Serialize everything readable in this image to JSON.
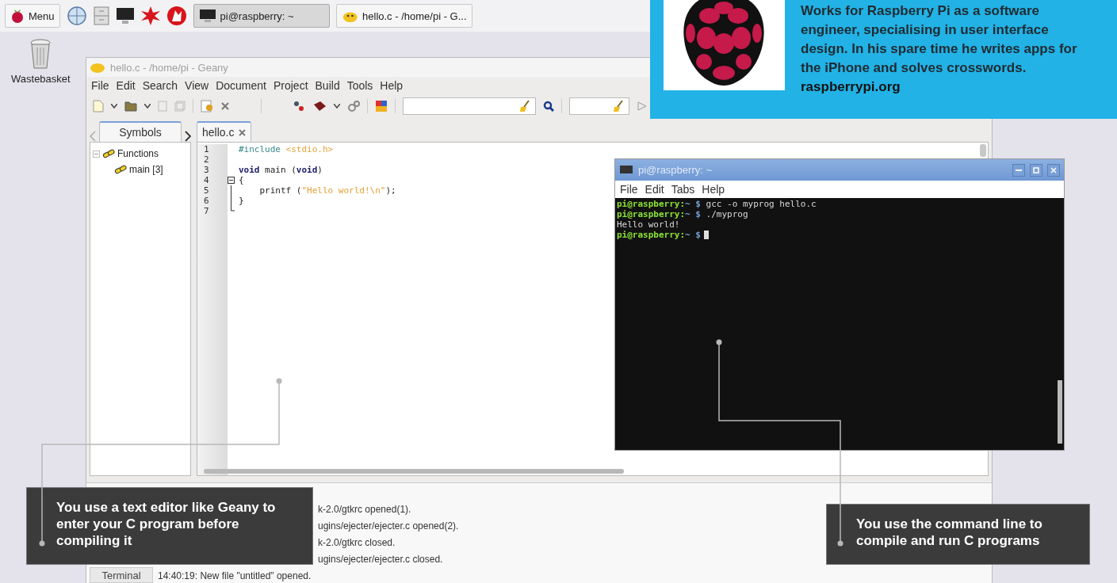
{
  "taskbar": {
    "menu_label": "Menu",
    "tasks": [
      {
        "label": "pi@raspberry: ~",
        "selected": true
      },
      {
        "label": "hello.c - /home/pi - G...",
        "selected": false
      }
    ]
  },
  "desktop_icons": [
    {
      "label": "Wastebasket"
    }
  ],
  "geany": {
    "title": "hello.c - /home/pi - Geany",
    "menu": [
      "File",
      "Edit",
      "Search",
      "View",
      "Document",
      "Project",
      "Build",
      "Tools",
      "Help"
    ],
    "sidebar_tabs": [
      {
        "label": "Symbols",
        "selected": true
      }
    ],
    "symbols": [
      {
        "label": "Functions",
        "expanded": true,
        "children": [
          {
            "label": "main [3]"
          }
        ]
      }
    ],
    "file_tabs": [
      {
        "label": "hello.c",
        "selected": true
      }
    ],
    "code_lines": [
      {
        "number": "1",
        "kind": "plain",
        "tokens": [
          {
            "kind": "preprocessor",
            "text": "#include "
          },
          {
            "kind": "string",
            "text": "<stdio.h>"
          }
        ]
      },
      {
        "number": "2",
        "kind": "plain"
      },
      {
        "number": "3",
        "kind": "plain",
        "tokens": [
          {
            "kind": "keyword",
            "text": "void"
          },
          {
            "kind": "plain",
            "text": " main ("
          },
          {
            "kind": "keyword",
            "text": "void"
          },
          {
            "kind": "plain",
            "text": ")"
          }
        ]
      },
      {
        "number": "4",
        "kind": "fold_start",
        "tokens": [
          {
            "kind": "plain",
            "text": "{"
          }
        ]
      },
      {
        "number": "5",
        "kind": "fold_body",
        "tokens": [
          {
            "kind": "plain",
            "text": "    printf ("
          },
          {
            "kind": "string",
            "text": "\"Hello world!\\n\""
          },
          {
            "kind": "plain",
            "text": ");"
          }
        ]
      },
      {
        "number": "6",
        "kind": "fold_body",
        "tokens": [
          {
            "kind": "plain",
            "text": "}"
          }
        ]
      },
      {
        "number": "7",
        "kind": "fold_end"
      }
    ],
    "message_tabs": [
      {
        "label": "Terminal"
      }
    ],
    "log": [
      {
        "text": "k-2.0/gtkrc opened(1)."
      },
      {
        "text": "ugins/ejecter/ejecter.c opened(2)."
      },
      {
        "text": "k-2.0/gtkrc closed."
      },
      {
        "text": "ugins/ejecter/ejecter.c closed."
      },
      {
        "text": "14:40:19: New file \"untitled\" opened."
      }
    ]
  },
  "terminal": {
    "title": "pi@raspberry: ~",
    "menu": [
      "File",
      "Edit",
      "Tabs",
      "Help"
    ],
    "lines": [
      {
        "kind": "prompt",
        "user": "pi@raspberry:",
        "path": "~ $",
        "command": " gcc -o myprog hello.c",
        "cursor": false
      },
      {
        "kind": "prompt",
        "user": "pi@raspberry:",
        "path": "~ $",
        "command": " ./myprog",
        "cursor": false
      },
      {
        "kind": "output",
        "text": "Hello world!"
      },
      {
        "kind": "prompt",
        "user": "pi@raspberry:",
        "path": "~ $",
        "cursor": true
      }
    ]
  },
  "bio": {
    "text": "Works for Raspberry Pi as a software engineer, specialising in user interface design. In his spare time he writes apps for the iPhone and solves crosswords.",
    "link": "raspberrypi.org"
  },
  "callouts": [
    {
      "text": "You use a text editor like Geany to enter your C program before compiling it"
    },
    {
      "text": "You use the command line to compile and run C programs"
    }
  ]
}
